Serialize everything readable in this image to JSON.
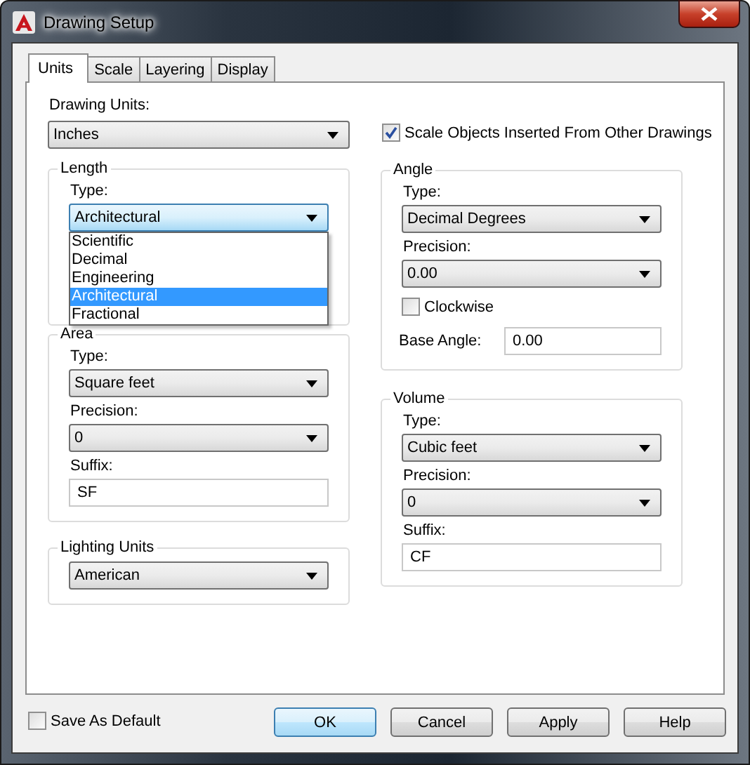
{
  "window": {
    "title": "Drawing Setup"
  },
  "tabs": [
    {
      "label": "Units",
      "selected": true
    },
    {
      "label": "Scale",
      "selected": false
    },
    {
      "label": "Layering",
      "selected": false
    },
    {
      "label": "Display",
      "selected": false
    }
  ],
  "drawing_units": {
    "label": "Drawing Units:",
    "value": "Inches"
  },
  "scale_objects": {
    "label": "Scale Objects Inserted From Other Drawings",
    "checked": true
  },
  "left_groups": [
    {
      "title": "Length",
      "fields": [
        {
          "kind": "combo",
          "label": "Type:",
          "value": "Architectural",
          "focused": true,
          "open": true,
          "options": [
            {
              "label": "Scientific",
              "selected": false
            },
            {
              "label": "Decimal",
              "selected": false
            },
            {
              "label": "Engineering",
              "selected": false
            },
            {
              "label": "Architectural",
              "selected": true
            },
            {
              "label": "Fractional",
              "selected": false
            }
          ]
        }
      ]
    },
    {
      "title": "Area",
      "fields": [
        {
          "kind": "combo",
          "label": "Type:",
          "value": "Square feet"
        },
        {
          "kind": "combo",
          "label": "Precision:",
          "value": "0"
        },
        {
          "kind": "text",
          "label": "Suffix:",
          "value": "SF"
        }
      ]
    },
    {
      "title": "Lighting Units",
      "fields": [
        {
          "kind": "combo",
          "value": "American"
        }
      ]
    }
  ],
  "right_groups": [
    {
      "title": "Angle",
      "fields": [
        {
          "kind": "combo",
          "label": "Type:",
          "value": "Decimal Degrees"
        },
        {
          "kind": "combo",
          "label": "Precision:",
          "value": "0.00"
        },
        {
          "kind": "checkbox",
          "label": "Clockwise",
          "checked": false
        },
        {
          "kind": "inline_text",
          "label": "Base Angle:",
          "value": "0.00"
        }
      ]
    },
    {
      "title": "Volume",
      "fields": [
        {
          "kind": "combo",
          "label": "Type:",
          "value": "Cubic feet"
        },
        {
          "kind": "combo",
          "label": "Precision:",
          "value": "0"
        },
        {
          "kind": "text",
          "label": "Suffix:",
          "value": "CF"
        }
      ]
    }
  ],
  "save_as_default": {
    "label": "Save As Default",
    "checked": false
  },
  "buttons": [
    {
      "label": "OK",
      "default": true
    },
    {
      "label": "Cancel",
      "default": false
    },
    {
      "label": "Apply",
      "default": false
    },
    {
      "label": "Help",
      "default": false
    }
  ]
}
